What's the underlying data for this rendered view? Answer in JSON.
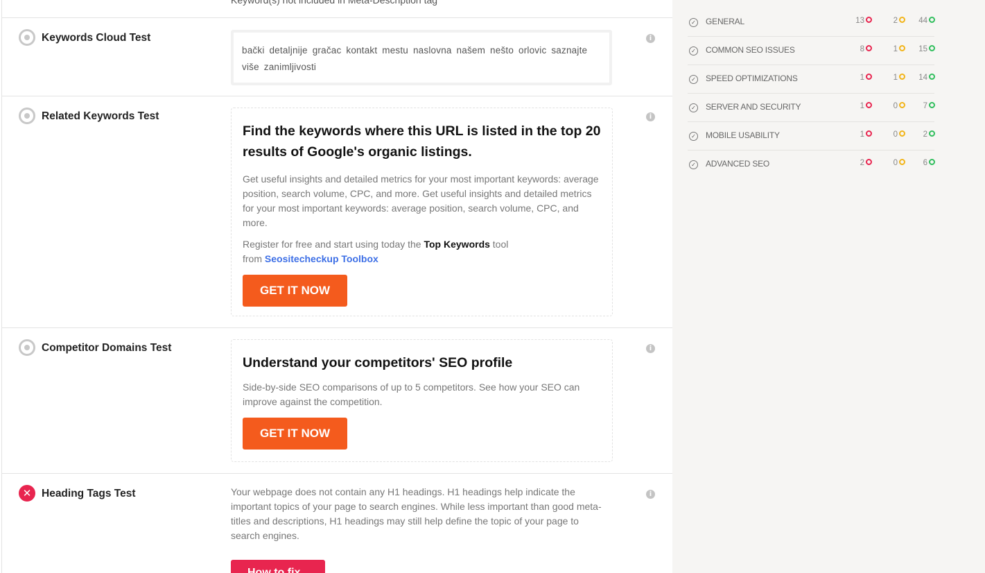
{
  "top_cut_text": "Keyword(s) not included in Meta-Description tag",
  "tests": {
    "keywords_cloud": {
      "title": "Keywords Cloud Test",
      "cloud": "bački detaljnije gračac kontakt mestu naslovna našem nešto orlovic saznajte više zanimljivosti"
    },
    "related_keywords": {
      "title": "Related Keywords Test",
      "promo_heading": "Find the keywords where this URL is listed in the top 20 results of Google's organic listings.",
      "promo_text": "Get useful insights and detailed metrics for your most important keywords: average position, search volume, CPC, and more. Get useful insights and detailed metrics for your most important keywords: average position, search volume, CPC, and more.",
      "register_prefix": "Register for free and start using today the ",
      "register_tool": "Top Keywords",
      "register_mid": " tool",
      "register_from": "from ",
      "register_link": "Seositecheckup Toolbox",
      "button": "GET IT NOW"
    },
    "competitor_domains": {
      "title": "Competitor Domains Test",
      "promo_heading": "Understand your competitors' SEO profile",
      "promo_text": "Side-by-side SEO comparisons of up to 5 competitors. See how your SEO can improve against the competition.",
      "button": "GET IT NOW"
    },
    "heading_tags": {
      "title": "Heading Tags Test",
      "text": "Your webpage does not contain any H1 headings. H1 headings help indicate the important topics of your page to search engines. While less important than good meta-titles and descriptions, H1 headings may still help define the topic of your page to search engines.",
      "button": "How to fix"
    }
  },
  "status_icons": {
    "neutral": "radio-dot-icon",
    "fail": "x",
    "info": "i"
  },
  "colors": {
    "fail": "#e8254f",
    "warning": "#f2b418",
    "pass": "#2fbe5c",
    "accent": "#f45b1d",
    "link": "#3d6fe6"
  },
  "sidebar": {
    "categories": [
      {
        "label": "GENERAL",
        "failed": "13",
        "warnings": "2",
        "passed": "44"
      },
      {
        "label": "COMMON SEO ISSUES",
        "failed": "8",
        "warnings": "1",
        "passed": "15"
      },
      {
        "label": "SPEED OPTIMIZATIONS",
        "failed": "1",
        "warnings": "1",
        "passed": "14"
      },
      {
        "label": "SERVER AND SECURITY",
        "failed": "1",
        "warnings": "0",
        "passed": "7"
      },
      {
        "label": "MOBILE USABILITY",
        "failed": "1",
        "warnings": "0",
        "passed": "2"
      },
      {
        "label": "ADVANCED SEO",
        "failed": "2",
        "warnings": "0",
        "passed": "6"
      }
    ]
  }
}
